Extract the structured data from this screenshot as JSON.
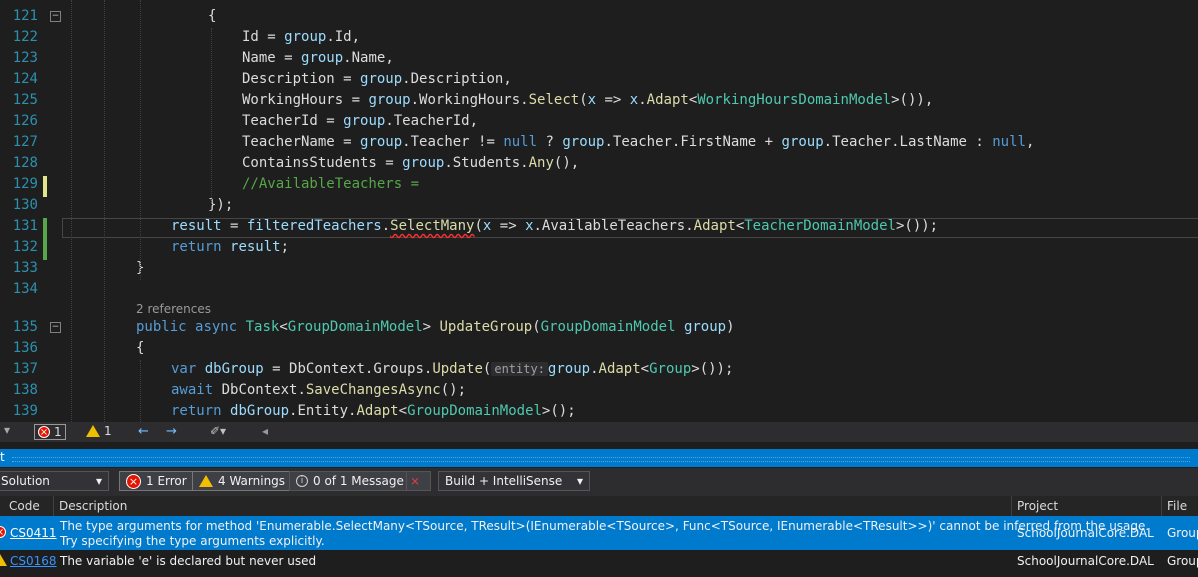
{
  "editor": {
    "lines": [
      {
        "num": "121",
        "tokens": [
          {
            "t": "{",
            "c": ""
          }
        ],
        "indent": 208
      },
      {
        "num": "122",
        "tokens": [
          {
            "t": "Id = ",
            "c": ""
          },
          {
            "t": "group",
            "c": "var"
          },
          {
            "t": ".Id,",
            "c": ""
          }
        ],
        "indent": 242
      },
      {
        "num": "123",
        "tokens": [
          {
            "t": "Name = ",
            "c": ""
          },
          {
            "t": "group",
            "c": "var"
          },
          {
            "t": ".Name,",
            "c": ""
          }
        ],
        "indent": 242
      },
      {
        "num": "124",
        "tokens": [
          {
            "t": "Description = ",
            "c": ""
          },
          {
            "t": "group",
            "c": "var"
          },
          {
            "t": ".Description,",
            "c": ""
          }
        ],
        "indent": 242
      },
      {
        "num": "125",
        "tokens": [
          {
            "t": "WorkingHours = ",
            "c": ""
          },
          {
            "t": "group",
            "c": "var"
          },
          {
            "t": ".WorkingHours.",
            "c": ""
          },
          {
            "t": "Select",
            "c": "method"
          },
          {
            "t": "(",
            "c": ""
          },
          {
            "t": "x",
            "c": "var"
          },
          {
            "t": " => ",
            "c": ""
          },
          {
            "t": "x",
            "c": "var"
          },
          {
            "t": ".",
            "c": ""
          },
          {
            "t": "Adapt",
            "c": "method"
          },
          {
            "t": "<",
            "c": ""
          },
          {
            "t": "WorkingHoursDomainModel",
            "c": "type"
          },
          {
            "t": ">()),",
            "c": ""
          }
        ],
        "indent": 242
      },
      {
        "num": "126",
        "tokens": [
          {
            "t": "TeacherId = ",
            "c": ""
          },
          {
            "t": "group",
            "c": "var"
          },
          {
            "t": ".TeacherId,",
            "c": ""
          }
        ],
        "indent": 242
      },
      {
        "num": "127",
        "tokens": [
          {
            "t": "TeacherName = ",
            "c": ""
          },
          {
            "t": "group",
            "c": "var"
          },
          {
            "t": ".Teacher != ",
            "c": ""
          },
          {
            "t": "null",
            "c": "kw"
          },
          {
            "t": " ? ",
            "c": ""
          },
          {
            "t": "group",
            "c": "var"
          },
          {
            "t": ".Teacher.FirstName + ",
            "c": ""
          },
          {
            "t": "group",
            "c": "var"
          },
          {
            "t": ".Teacher.LastName : ",
            "c": ""
          },
          {
            "t": "null",
            "c": "kw"
          },
          {
            "t": ",",
            "c": ""
          }
        ],
        "indent": 242
      },
      {
        "num": "128",
        "tokens": [
          {
            "t": "ContainsStudents = ",
            "c": ""
          },
          {
            "t": "group",
            "c": "var"
          },
          {
            "t": ".Students.",
            "c": ""
          },
          {
            "t": "Any",
            "c": "method"
          },
          {
            "t": "(),",
            "c": ""
          }
        ],
        "indent": 242
      },
      {
        "num": "129",
        "tokens": [
          {
            "t": "//AvailableTeachers =",
            "c": "cmt"
          }
        ],
        "indent": 242
      },
      {
        "num": "130",
        "tokens": [
          {
            "t": "});",
            "c": ""
          }
        ],
        "indent": 208
      },
      {
        "num": "131",
        "tokens": [
          {
            "t": "result",
            "c": "var"
          },
          {
            "t": " = ",
            "c": ""
          },
          {
            "t": "filteredTeachers",
            "c": "var"
          },
          {
            "t": ".",
            "c": ""
          },
          {
            "t": "SelectMany",
            "c": "method err"
          },
          {
            "t": "(",
            "c": ""
          },
          {
            "t": "x",
            "c": "var"
          },
          {
            "t": " => ",
            "c": ""
          },
          {
            "t": "x",
            "c": "var"
          },
          {
            "t": ".AvailableTeachers.",
            "c": ""
          },
          {
            "t": "Adapt",
            "c": "method"
          },
          {
            "t": "<",
            "c": ""
          },
          {
            "t": "TeacherDomainModel",
            "c": "type"
          },
          {
            "t": ">());",
            "c": ""
          }
        ],
        "indent": 171
      },
      {
        "num": "132",
        "tokens": [
          {
            "t": "return",
            "c": "kw"
          },
          {
            "t": " ",
            "c": ""
          },
          {
            "t": "result",
            "c": "var"
          },
          {
            "t": ";",
            "c": ""
          }
        ],
        "indent": 171
      },
      {
        "num": "133",
        "tokens": [
          {
            "t": "}",
            "c": ""
          }
        ],
        "indent": 136
      },
      {
        "num": "134",
        "tokens": [],
        "indent": 136
      },
      {
        "num": "135",
        "tokens": [
          {
            "t": "public",
            "c": "kw"
          },
          {
            "t": " ",
            "c": ""
          },
          {
            "t": "async",
            "c": "kw"
          },
          {
            "t": " ",
            "c": ""
          },
          {
            "t": "Task",
            "c": "type"
          },
          {
            "t": "<",
            "c": ""
          },
          {
            "t": "GroupDomainModel",
            "c": "type"
          },
          {
            "t": "> ",
            "c": ""
          },
          {
            "t": "UpdateGroup",
            "c": "method"
          },
          {
            "t": "(",
            "c": ""
          },
          {
            "t": "GroupDomainModel",
            "c": "type"
          },
          {
            "t": " ",
            "c": ""
          },
          {
            "t": "group",
            "c": "var"
          },
          {
            "t": ")",
            "c": ""
          }
        ],
        "indent": 136
      },
      {
        "num": "136",
        "tokens": [
          {
            "t": "{",
            "c": ""
          }
        ],
        "indent": 136
      },
      {
        "num": "137",
        "tokens": [
          {
            "t": "var",
            "c": "kw"
          },
          {
            "t": " ",
            "c": ""
          },
          {
            "t": "dbGroup",
            "c": "var"
          },
          {
            "t": " = DbContext.Groups.",
            "c": ""
          },
          {
            "t": "Update",
            "c": "method"
          },
          {
            "t": "(",
            "c": ""
          },
          {
            "t": "entity:",
            "c": "hint"
          },
          {
            "t": "group",
            "c": "var"
          },
          {
            "t": ".",
            "c": ""
          },
          {
            "t": "Adapt",
            "c": "method"
          },
          {
            "t": "<",
            "c": ""
          },
          {
            "t": "Group",
            "c": "type"
          },
          {
            "t": ">());",
            "c": ""
          }
        ],
        "indent": 171
      },
      {
        "num": "138",
        "tokens": [
          {
            "t": "await",
            "c": "kw"
          },
          {
            "t": " DbContext.",
            "c": ""
          },
          {
            "t": "SaveChangesAsync",
            "c": "method"
          },
          {
            "t": "();",
            "c": ""
          }
        ],
        "indent": 171
      },
      {
        "num": "139",
        "tokens": [
          {
            "t": "return",
            "c": "kw"
          },
          {
            "t": " ",
            "c": ""
          },
          {
            "t": "dbGroup",
            "c": "var"
          },
          {
            "t": ".Entity.",
            "c": ""
          },
          {
            "t": "Adapt",
            "c": "method"
          },
          {
            "t": "<",
            "c": ""
          },
          {
            "t": "GroupDomainModel",
            "c": "type"
          },
          {
            "t": ">();",
            "c": ""
          }
        ],
        "indent": 171
      }
    ],
    "codelens": "2 references"
  },
  "editor_status": {
    "error_count": "1",
    "warning_count": "1"
  },
  "error_list": {
    "title": "t",
    "scope": "Solution",
    "errors_btn": "1 Error",
    "warnings_btn": "4 Warnings",
    "messages_btn": "0 of 1 Message",
    "build_filter": "Build + IntelliSense",
    "columns": {
      "code": "Code",
      "description": "Description",
      "project": "Project",
      "file": "File"
    },
    "rows": [
      {
        "code": "CS0411",
        "description_line1": "The type arguments for method 'Enumerable.SelectMany<TSource, TResult>(IEnumerable<TSource>, Func<TSource, IEnumerable<TResult>>)' cannot be inferred from the usage.",
        "description_line2": "Try specifying the type arguments explicitly.",
        "project": "SchoolJournalCore.DAL",
        "file": "Group"
      },
      {
        "code": "CS0168",
        "description_line1": "The variable 'e' is declared but never used",
        "project": "SchoolJournalCore.DAL",
        "file": "Group"
      }
    ]
  },
  "colors": {
    "accent": "#007acc",
    "selected_row": "#007acc",
    "error": "#e51400",
    "warning": "#f0c000"
  }
}
